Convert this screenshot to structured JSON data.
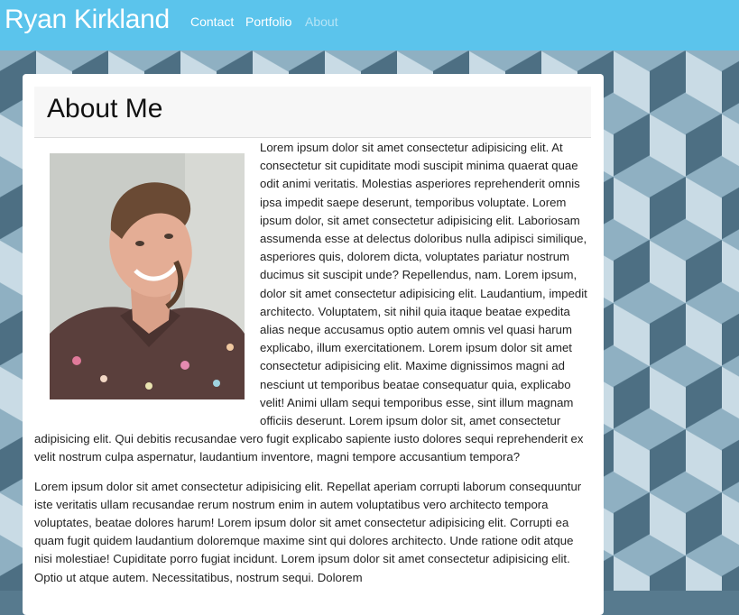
{
  "navbar": {
    "brand": "Ryan Kirkland",
    "links": [
      {
        "label": "Contact"
      },
      {
        "label": "Portfolio"
      },
      {
        "label": "About"
      }
    ],
    "active_link": "About",
    "bg_color": "#5bc4ec"
  },
  "about": {
    "title": "About Me",
    "photo_icon": "profile-photo",
    "paragraphs": [
      "Lorem ipsum dolor sit amet consectetur adipisicing elit. At consectetur sit cupiditate modi suscipit minima quaerat quae odit animi veritatis. Molestias asperiores reprehenderit omnis ipsa impedit saepe deserunt, temporibus voluptate. Lorem ipsum dolor, sit amet consectetur adipisicing elit. Laboriosam assumenda esse at delectus doloribus nulla adipisci similique, asperiores quis, dolorem dicta, voluptates pariatur nostrum ducimus sit suscipit unde? Repellendus, nam. Lorem ipsum, dolor sit amet consectetur adipisicing elit. Laudantium, impedit architecto. Voluptatem, sit nihil quia itaque beatae expedita alias neque accusamus optio autem omnis vel quasi harum explicabo, illum exercitationem. Lorem ipsum dolor sit amet consectetur adipisicing elit. Maxime dignissimos magni ad nesciunt ut temporibus beatae consequatur quia, explicabo velit! Animi ullam sequi temporibus esse, sint illum magnam officiis deserunt. Lorem ipsum dolor sit, amet consectetur adipisicing elit. Qui debitis recusandae vero fugit explicabo sapiente iusto dolores sequi reprehenderit ex velit nostrum culpa aspernatur, laudantium inventore, magni tempore accusantium tempora?",
      "Lorem ipsum dolor sit amet consectetur adipisicing elit. Repellat aperiam corrupti laborum consequuntur iste veritatis ullam recusandae rerum nostrum enim in autem voluptatibus vero architecto tempora voluptates, beatae dolores harum! Lorem ipsum dolor sit amet consectetur adipisicing elit. Corrupti ea quam fugit quidem laudantium doloremque maxime sint qui dolores architecto. Unde ratione odit atque nisi molestiae! Cupiditate porro fugiat incidunt. Lorem ipsum dolor sit amet consectetur adipisicing elit. Optio ut atque autem. Necessitatibus, nostrum sequi. Dolorem"
    ]
  }
}
